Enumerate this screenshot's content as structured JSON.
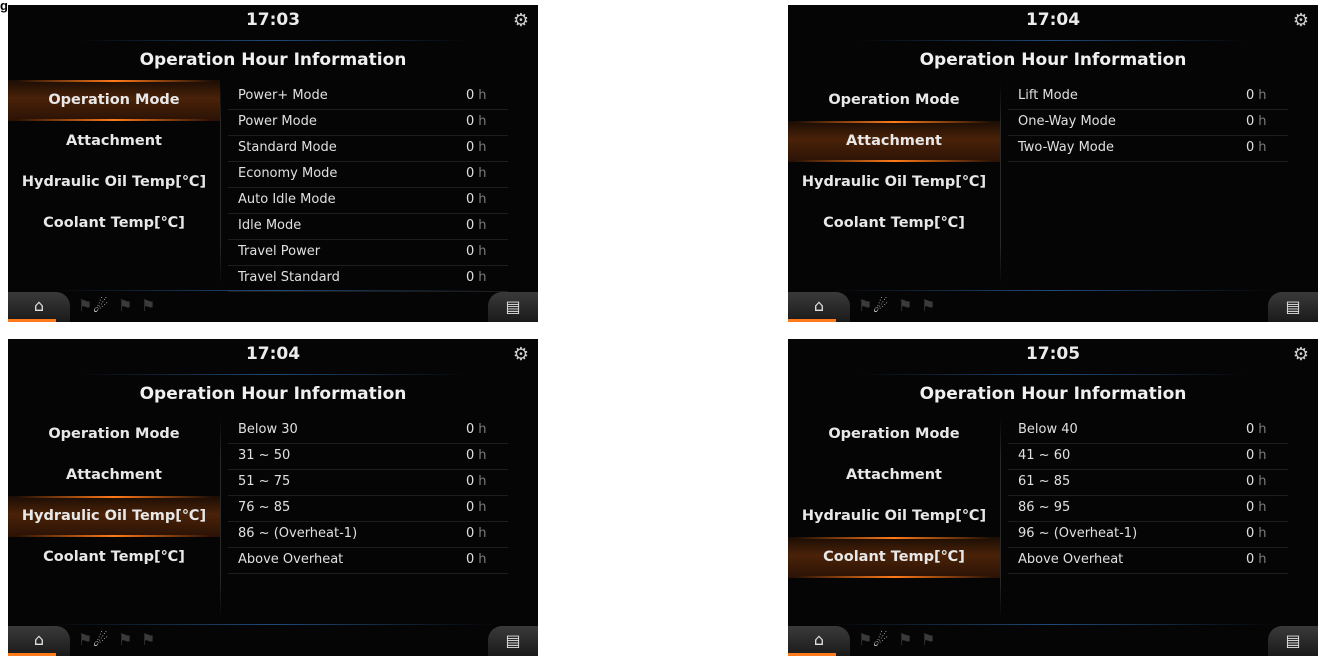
{
  "figure_label": "g",
  "menu": [
    "Operation Mode",
    "Attachment",
    "Hydraulic Oil Temp[℃]",
    "Coolant Temp[℃]"
  ],
  "title": "Operation Hour Information",
  "unit": "h",
  "colors": {
    "accent": "#ff7a1a",
    "background": "#050505",
    "divider_blue": "#1f4a78"
  },
  "icons": {
    "top_right": "cluster-settings-icon",
    "bottom_left": "operator-seat-icon",
    "bottom_middle": "machine-icon",
    "bottom_right": "radio-icon"
  },
  "screens": [
    {
      "time": "17:03",
      "active_menu": 0,
      "rows": [
        {
          "label": "Power+ Mode",
          "value": "0"
        },
        {
          "label": "Power Mode",
          "value": "0"
        },
        {
          "label": "Standard Mode",
          "value": "0"
        },
        {
          "label": "Economy Mode",
          "value": "0"
        },
        {
          "label": "Auto Idle Mode",
          "value": "0"
        },
        {
          "label": "Idle Mode",
          "value": "0"
        },
        {
          "label": "Travel Power",
          "value": "0"
        },
        {
          "label": "Travel Standard",
          "value": "0"
        }
      ]
    },
    {
      "time": "17:04",
      "active_menu": 1,
      "rows": [
        {
          "label": "Lift Mode",
          "value": "0"
        },
        {
          "label": "One-Way Mode",
          "value": "0"
        },
        {
          "label": "Two-Way Mode",
          "value": "0"
        }
      ]
    },
    {
      "time": "17:04",
      "active_menu": 2,
      "rows": [
        {
          "label": "Below 30",
          "value": "0"
        },
        {
          "label": "31 ~ 50",
          "value": "0"
        },
        {
          "label": "51 ~ 75",
          "value": "0"
        },
        {
          "label": "76 ~ 85",
          "value": "0"
        },
        {
          "label": "86 ~ (Overheat-1)",
          "value": "0"
        },
        {
          "label": "Above Overheat",
          "value": "0"
        }
      ]
    },
    {
      "time": "17:05",
      "active_menu": 3,
      "rows": [
        {
          "label": "Below 40",
          "value": "0"
        },
        {
          "label": "41 ~ 60",
          "value": "0"
        },
        {
          "label": "61 ~ 85",
          "value": "0"
        },
        {
          "label": "86 ~ 95",
          "value": "0"
        },
        {
          "label": "96 ~ (Overheat-1)",
          "value": "0"
        },
        {
          "label": "Above Overheat",
          "value": "0"
        }
      ]
    }
  ]
}
